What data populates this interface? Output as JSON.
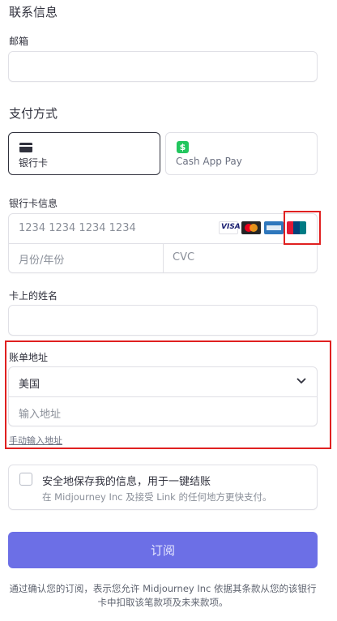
{
  "contact": {
    "title": "联系信息",
    "email_label": "邮箱",
    "email_value": ""
  },
  "payment": {
    "title": "支付方式",
    "methods": [
      {
        "label": "银行卡",
        "icon": "card-icon",
        "selected": true
      },
      {
        "label": "Cash App Pay",
        "icon": "cash-app-icon",
        "selected": false
      }
    ]
  },
  "card": {
    "title": "银行卡信息",
    "number_placeholder": "1234 1234 1234 1234",
    "expiry_placeholder": "月份/年份",
    "cvc_placeholder": "CVC",
    "brands": [
      "VISA",
      "Mastercard",
      "American Express",
      "UnionPay"
    ],
    "visa_text": "VISA"
  },
  "name": {
    "label": "卡上的姓名",
    "value": ""
  },
  "billing": {
    "label": "账单地址",
    "country": "美国",
    "address_placeholder": "输入地址",
    "manual_link": "手动输入地址"
  },
  "save": {
    "title": "安全地保存我的信息，用于一键结账",
    "subtitle": "在 Midjourney Inc 及接受 Link 的任何地方更快支付。",
    "checked": false
  },
  "subscribe_label": "订阅",
  "legal": "通过确认您的订阅，表示您允许 Midjourney Inc 依据其条款从您的该银行卡中扣取该笔款项及未来款项。",
  "colors": {
    "accent": "#6c6fe6",
    "highlight": "#e02020",
    "cash_app_green": "#22c65e"
  }
}
